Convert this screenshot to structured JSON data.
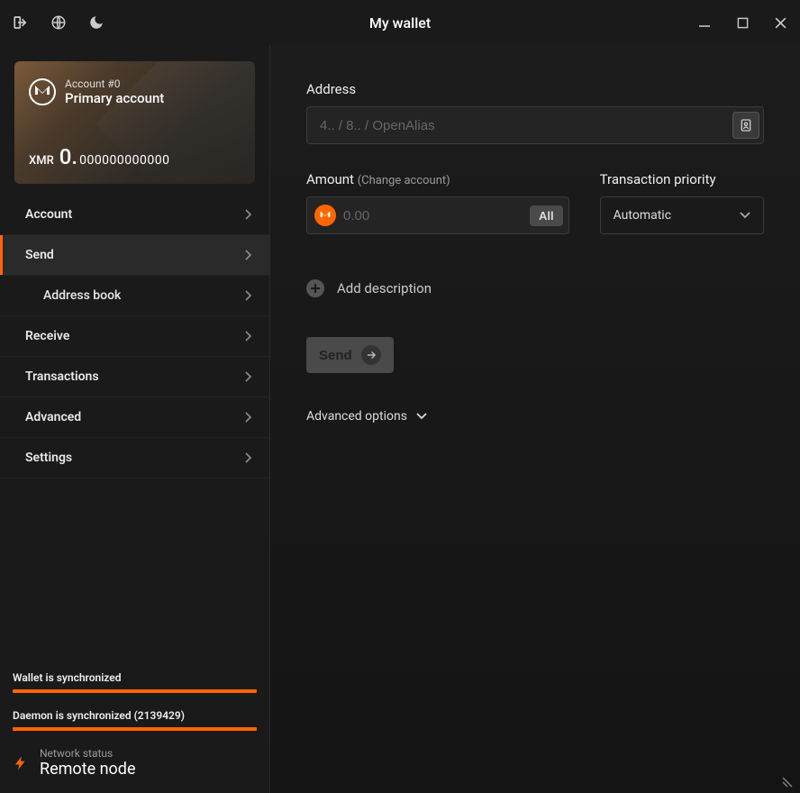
{
  "titlebar": {
    "title": "My wallet"
  },
  "sidebar": {
    "card": {
      "account_label": "Account #0",
      "account_name": "Primary account",
      "currency": "XMR",
      "balance_int": "0.",
      "balance_dec": "000000000000"
    },
    "nav": [
      {
        "label": "Account"
      },
      {
        "label": "Send"
      },
      {
        "label": "Address book"
      },
      {
        "label": "Receive"
      },
      {
        "label": "Transactions"
      },
      {
        "label": "Advanced"
      },
      {
        "label": "Settings"
      }
    ],
    "status": {
      "wallet_sync": "Wallet is synchronized",
      "daemon_sync": "Daemon is synchronized (2139429)",
      "network_label": "Network status",
      "network_value": "Remote node"
    }
  },
  "send": {
    "address_label": "Address",
    "address_placeholder": "4.. / 8.. / OpenAlias",
    "amount_label": "Amount",
    "amount_sub": "(Change account)",
    "amount_placeholder": "0.00",
    "all_button": "All",
    "priority_label": "Transaction priority",
    "priority_value": "Automatic",
    "add_description": "Add description",
    "send_button": "Send",
    "advanced_options": "Advanced options"
  }
}
